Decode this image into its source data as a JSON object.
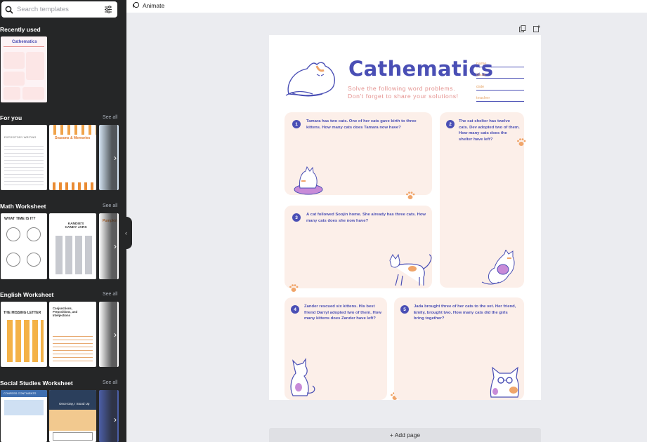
{
  "sidebar": {
    "search": {
      "placeholder": "Search templates"
    },
    "sections": [
      {
        "title": "Recently used",
        "see_all": ""
      },
      {
        "title": "For you",
        "see_all": "See all"
      },
      {
        "title": "Math Worksheet",
        "see_all": "See all"
      },
      {
        "title": "English Worksheet",
        "see_all": "See all"
      },
      {
        "title": "Social Studies Worksheet",
        "see_all": "See all"
      }
    ],
    "thumb_text": {
      "recent": "Cathematics",
      "foryou_1": "EXPOSITORY WRITING",
      "foryou_2": "Seasons & Memories",
      "math_1": "WHAT TIME IS IT?",
      "math_2": "KANDIE'S CANDY JARS",
      "math_3": "Pumpkin",
      "english_1": "THE MISSING LETTER",
      "english_2": "Conjunctions, Prepositions, and Interjections",
      "social_1": "CONFESS CONTINENTS",
      "social_2": "Once Day, I Stood Up"
    }
  },
  "topbar": {
    "animate_label": "Animate"
  },
  "canvas": {
    "add_page_label": "+ Add page"
  },
  "worksheet": {
    "title": "Cathematics",
    "subtitle_1": "Solve the following word problems.",
    "subtitle_2": "Don't forget to share your solutions!",
    "fields": [
      "name",
      "class",
      "date",
      "teacher"
    ],
    "problems": [
      {
        "number": "1",
        "text": "Tamara has two cats. One of her cats gave birth to three kittens. How many cats does Tamara now have?"
      },
      {
        "number": "2",
        "text": "The cat shelter has twelve cats. Dev adopted two of them. How many cats does the shelter have left?"
      },
      {
        "number": "3",
        "text": "A cat followed Soojin home. She already has three cats. How many cats does she now have?"
      },
      {
        "number": "4",
        "text": "Zander rescued six kittens. His best friend Darryl adopted two of them. How many kittens does Zander have left?"
      },
      {
        "number": "5",
        "text": "Jada brought three of her cats to the vet. Her friend, Emily, brought two. How many cats did the girls bring together?"
      }
    ]
  },
  "colors": {
    "sidebar_bg": "#252627",
    "accent": "#4a4fb5",
    "card_bg": "#fcefe9",
    "paw": "#f0a56a",
    "subtitle": "#e4918e"
  }
}
